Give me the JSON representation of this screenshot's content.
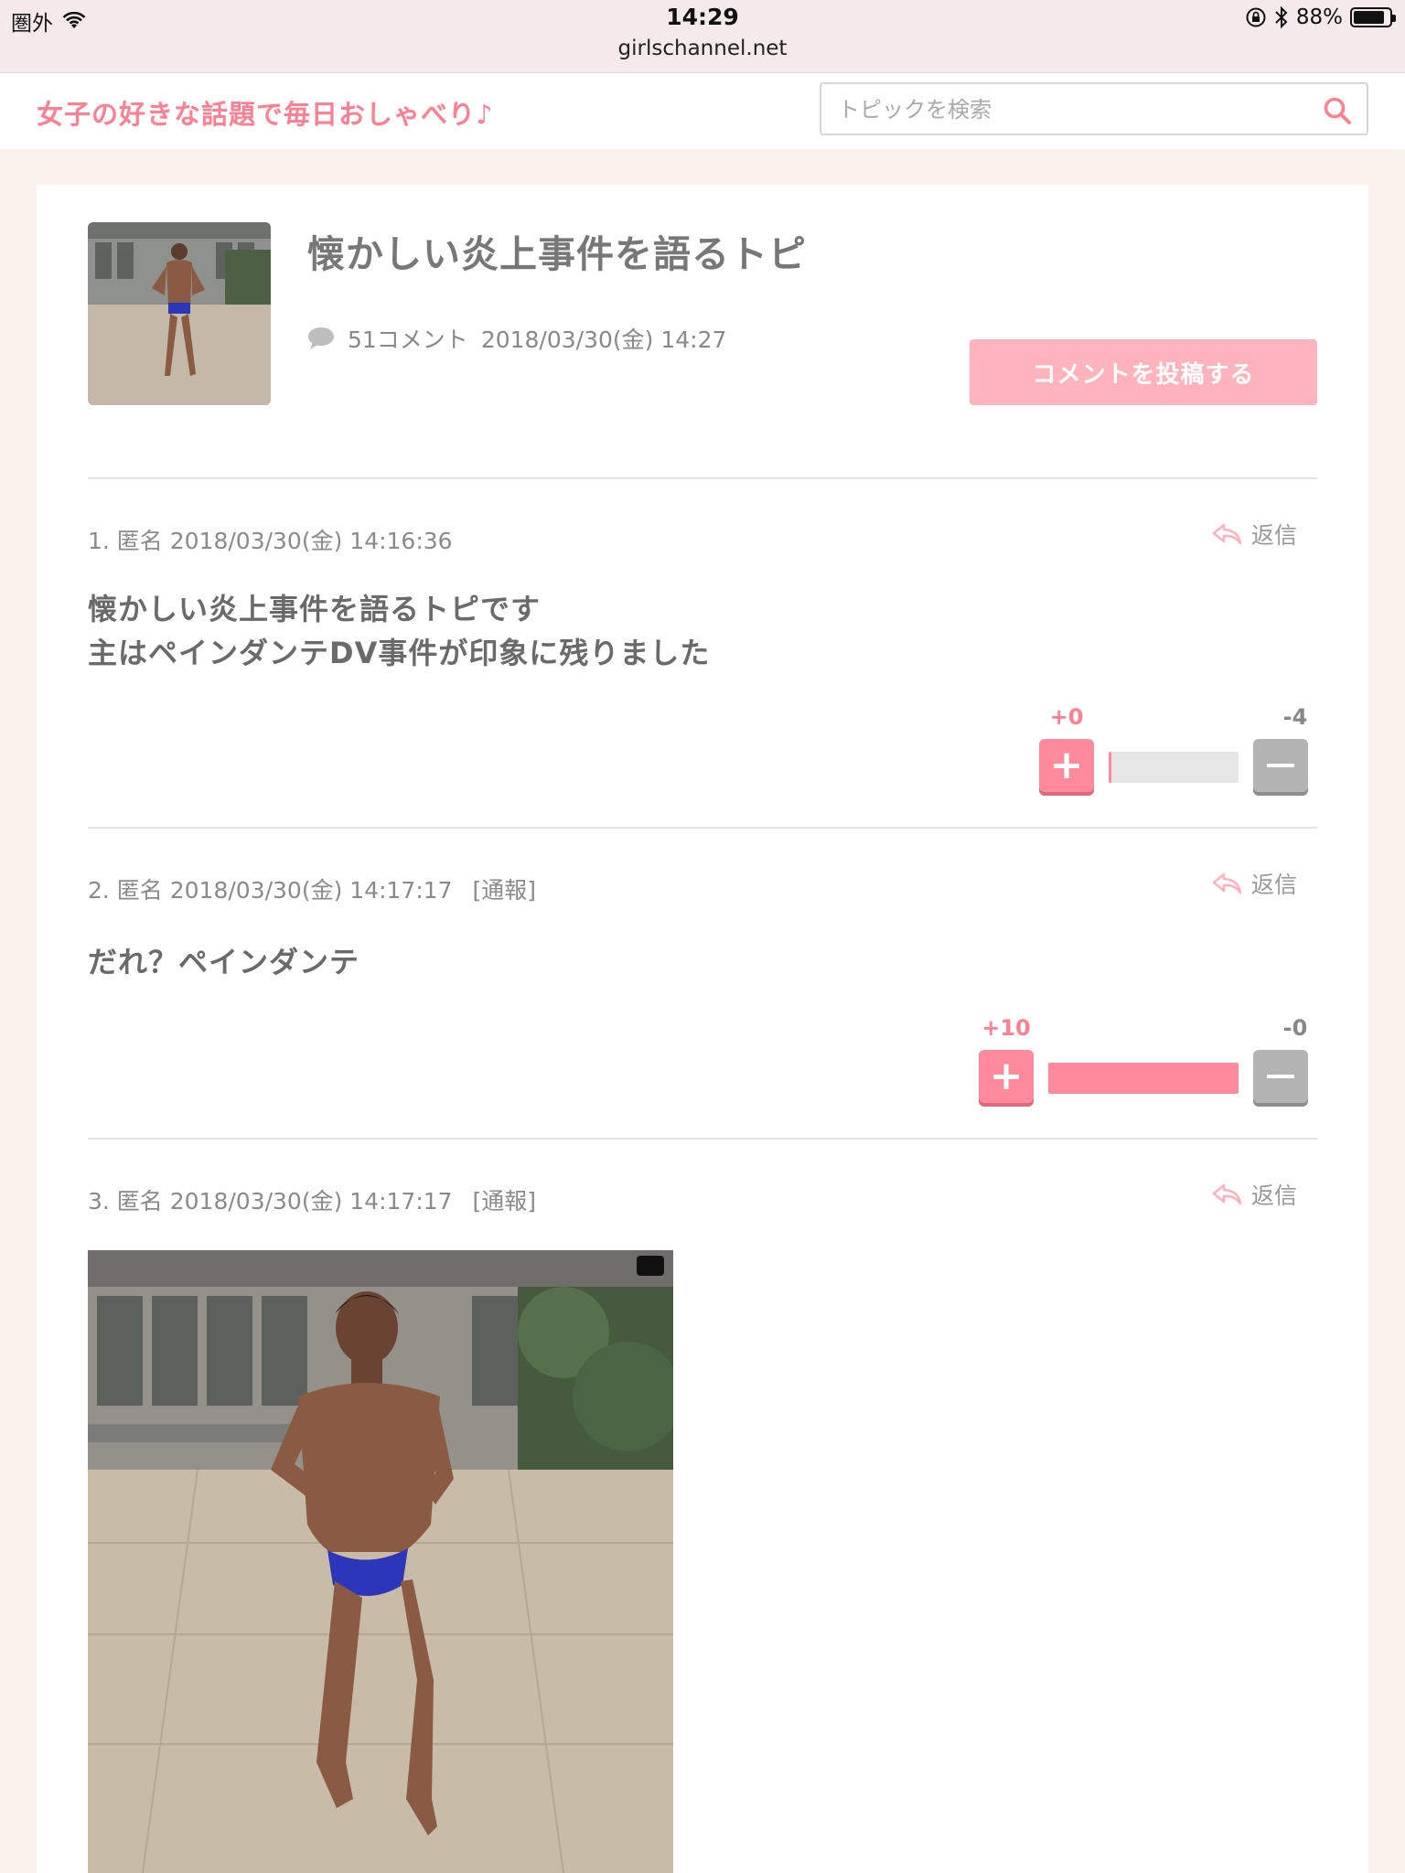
{
  "statusbar": {
    "carrier": "圏外",
    "time": "14:29",
    "url": "girlschannel.net",
    "battery": "88%",
    "battery_level": 0.88
  },
  "header": {
    "tagline": "女子の好きな話題で毎日おしゃべり♪",
    "search_placeholder": "トピックを検索"
  },
  "topic": {
    "title": "懐かしい炎上事件を語るトピ",
    "comment_count": "51コメント",
    "datetime": "2018/03/30(金) 14:27",
    "post_button": "コメントを投稿する"
  },
  "comments": [
    {
      "header": "1. 匿名 2018/03/30(金) 14:16:36",
      "report": "",
      "reply": "返信",
      "body_lines": [
        "懐かしい炎上事件を語るトピです",
        "主はペインダンテDV事件が印象に残りました"
      ],
      "plus": "+0",
      "minus": "-4",
      "plus_ratio": 0.0
    },
    {
      "header": "2. 匿名 2018/03/30(金) 14:17:17",
      "report": "[通報]",
      "reply": "返信",
      "body_lines": [
        "だれ？ペインダンテ"
      ],
      "plus": "+10",
      "minus": "-0",
      "plus_ratio": 1.0
    },
    {
      "header": "3. 匿名 2018/03/30(金) 14:17:17",
      "report": "[通報]",
      "reply": "返信"
    }
  ],
  "icons": {
    "search": "search-icon",
    "comment": "comment-bubble-icon",
    "reply": "reply-arrow-icon",
    "wifi": "wifi-icon",
    "lock_rotation": "rotation-lock-icon",
    "bluetooth": "bluetooth-icon"
  },
  "colors": {
    "accent": "#ff7f93",
    "button": "#ffb3bd",
    "plus": "#ff8a9b",
    "minus": "#b3b3b3",
    "background": "#fbf3eb"
  }
}
